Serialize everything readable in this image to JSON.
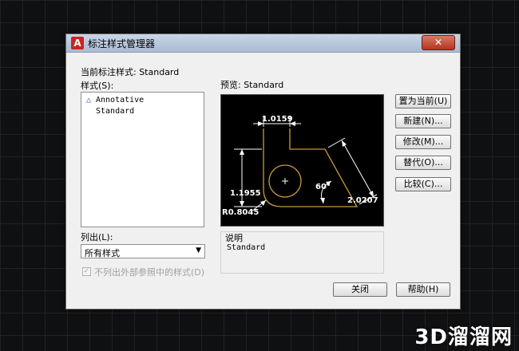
{
  "window": {
    "title": "标注样式管理器",
    "close_label": "✕"
  },
  "current_style_label": "当前标注样式: Standard",
  "styles_label": "样式(S):",
  "styles": [
    {
      "name": "Annotative",
      "icon": "annotative-icon"
    },
    {
      "name": "Standard"
    }
  ],
  "preview_label": "预览: Standard",
  "preview_dims": {
    "top": "1.0159",
    "left": "1.1955",
    "right": "2.0207",
    "angle": "60°",
    "radius": "R0.8045"
  },
  "buttons": {
    "set_current": "置为当前(U)",
    "new": "新建(N)...",
    "modify": "修改(M)...",
    "override": "替代(O)...",
    "compare": "比较(C)..."
  },
  "description": {
    "label": "说明",
    "text": "Standard"
  },
  "list_label": "列出(L):",
  "list_value": "所有样式",
  "exclude_xref_label": "不列出外部参照中的样式(D)",
  "close_button": "关闭",
  "help_button": "帮助(H)",
  "watermark": "3D溜溜网",
  "colors": {
    "preview_outline": "#c89a3a",
    "preview_dim": "#ffffff",
    "close": "#c7402b"
  }
}
